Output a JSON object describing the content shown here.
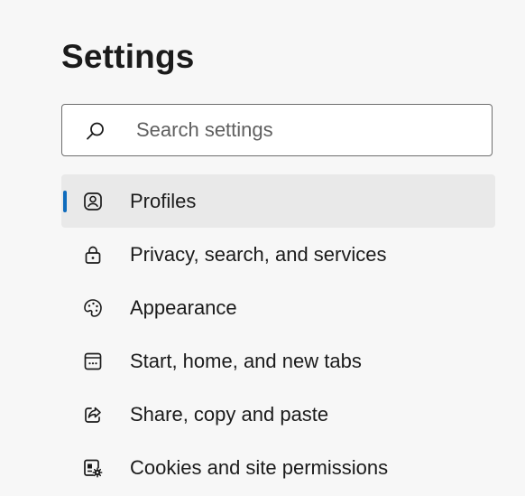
{
  "page": {
    "title": "Settings"
  },
  "search": {
    "placeholder": "Search settings",
    "value": "",
    "icon": "search-icon"
  },
  "nav": {
    "items": [
      {
        "label": "Profiles",
        "icon": "profile-icon",
        "selected": true
      },
      {
        "label": "Privacy, search, and services",
        "icon": "lock-icon",
        "selected": false
      },
      {
        "label": "Appearance",
        "icon": "palette-icon",
        "selected": false
      },
      {
        "label": "Start, home, and new tabs",
        "icon": "start-page-icon",
        "selected": false
      },
      {
        "label": "Share, copy and paste",
        "icon": "share-icon",
        "selected": false
      },
      {
        "label": "Cookies and site permissions",
        "icon": "site-permissions-icon",
        "selected": false
      }
    ]
  },
  "colors": {
    "accent": "#0f6cbd",
    "background": "#f7f7f7",
    "selected_background": "#e9e9e9",
    "text": "#1b1b1b"
  }
}
